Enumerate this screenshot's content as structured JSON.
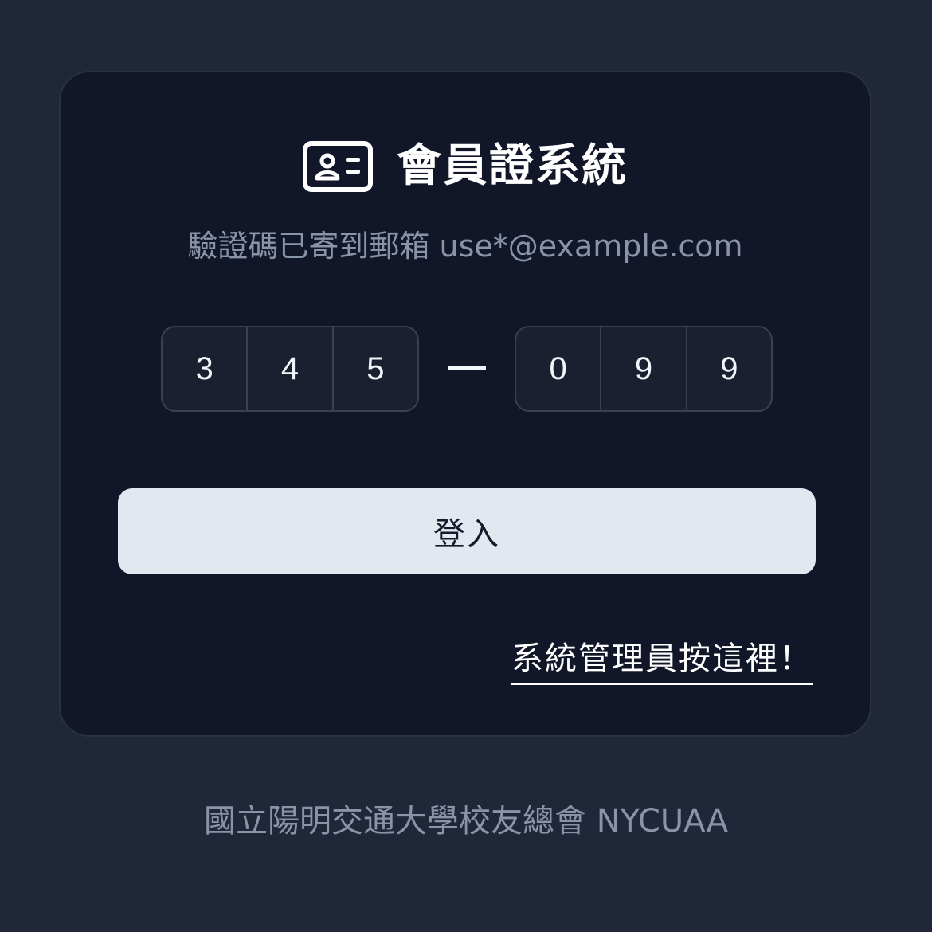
{
  "header": {
    "icon": "id-card-icon",
    "title": "會員證系統"
  },
  "subtitle": "驗證碼已寄到郵箱 use*@example.com",
  "otp": {
    "group1": [
      "3",
      "4",
      "5"
    ],
    "separator": "—",
    "group2": [
      "0",
      "9",
      "9"
    ]
  },
  "login_button": {
    "label": "登入"
  },
  "admin_link": {
    "label": "系統管理員按這裡！"
  },
  "footer": {
    "text": "國立陽明交通大學校友總會 NYCUAA"
  },
  "colors": {
    "background": "#1f2739",
    "card": "#111729",
    "button": "#e2e7f0",
    "muted_text": "#8a94a8"
  }
}
